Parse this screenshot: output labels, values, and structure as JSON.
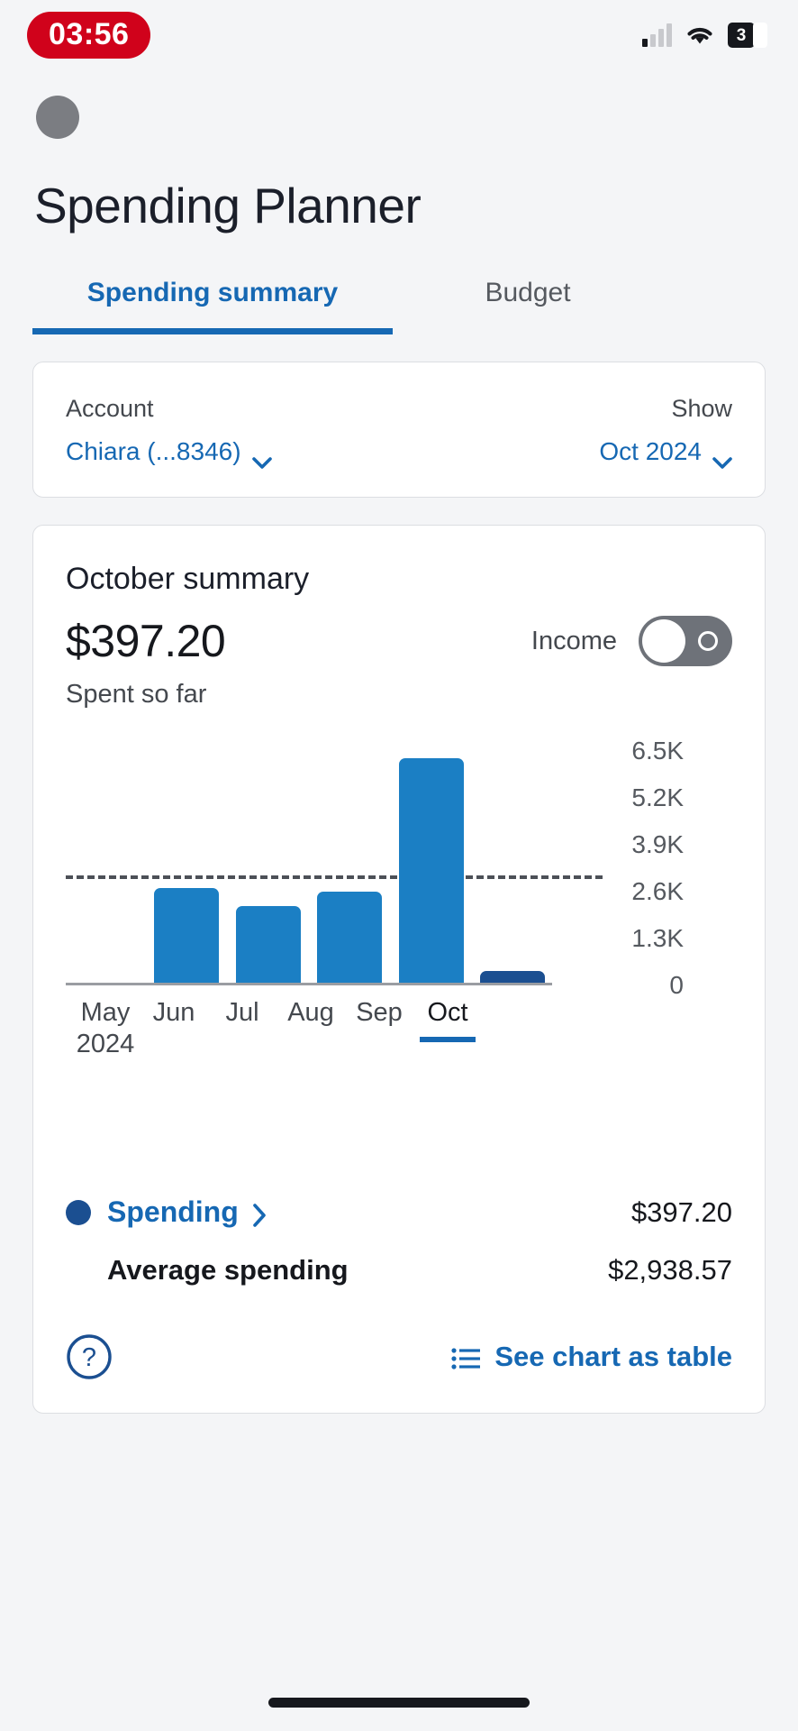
{
  "statusbar": {
    "time": "03:56",
    "battery_level": "3",
    "signal_icon": "signal-bars-icon",
    "wifi_icon": "wifi-icon",
    "battery_icon": "battery-icon"
  },
  "header": {
    "title": "Spending Planner",
    "avatar": "avatar"
  },
  "tabs": [
    {
      "label": "Spending summary",
      "active": true
    },
    {
      "label": "Budget",
      "active": false
    }
  ],
  "selectors": {
    "account_label": "Account",
    "account_value": "Chiara (...8346)",
    "show_label": "Show",
    "show_value": "Oct 2024"
  },
  "summary": {
    "title": "October summary",
    "amount": "$397.20",
    "spent_label": "Spent so far",
    "income_label": "Income",
    "income_toggle_state": "off"
  },
  "legend": {
    "spending_label": "Spending",
    "spending_value": "$397.20",
    "average_label": "Average spending",
    "average_value": "$2,938.57"
  },
  "footer": {
    "help_label": "?",
    "table_link": "See chart as table"
  },
  "colors": {
    "accent_blue": "#1668b3",
    "bar_blue": "#1b7fc4",
    "bar_dark_blue": "#1b4f91",
    "record_red": "#d0021b",
    "text_dark": "#16181d",
    "text_muted": "#44484e"
  },
  "chart_data": {
    "type": "bar",
    "title": "October summary",
    "categories": [
      "May",
      "Jun",
      "Jul",
      "Aug",
      "Sep",
      "Oct"
    ],
    "x_sub_label": "2024",
    "values": [
      0,
      2700,
      2200,
      2600,
      6300,
      397.2
    ],
    "selected_category": "Oct",
    "highlight_index": 5,
    "average_line": 2938.57,
    "ylim": [
      0,
      6500
    ],
    "yticks": [
      6500,
      5200,
      3900,
      2600,
      1300,
      0
    ],
    "ytick_labels": [
      "6.5K",
      "5.2K",
      "3.9K",
      "2.6K",
      "1.3K",
      "0"
    ],
    "xlabel": "",
    "ylabel": "",
    "grid": false,
    "legend": [
      {
        "name": "Spending",
        "value": "$397.20"
      },
      {
        "name": "Average spending",
        "value": "$2,938.57"
      }
    ]
  }
}
